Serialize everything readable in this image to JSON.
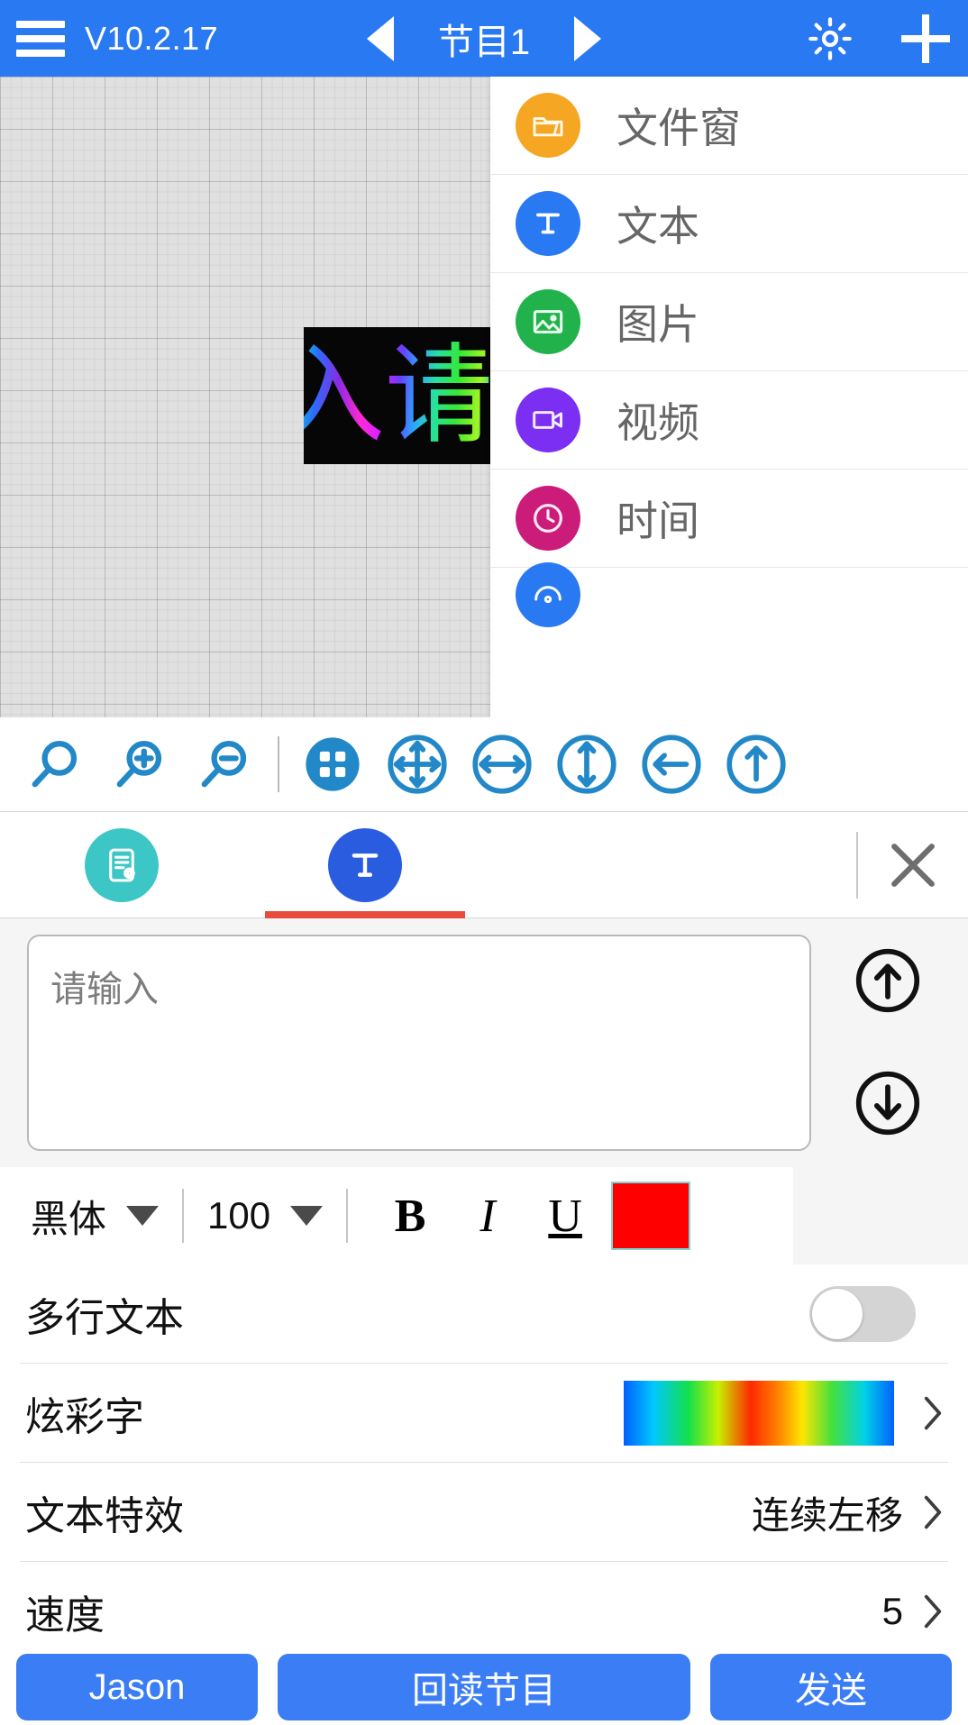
{
  "topbar": {
    "menu_icon": "hamburger-icon",
    "version": "V10.2.17",
    "prev_icon": "triangle-left-icon",
    "program_name": "节目1",
    "next_icon": "triangle-right-icon",
    "brightness_icon": "gear-icon",
    "add_icon": "plus-icon",
    "bg_color": "#2979f2"
  },
  "canvas": {
    "led_preview_text": "入请",
    "led_bg_color": "#060606",
    "grid_bg_color": "#e0e0e0"
  },
  "menu": {
    "items": [
      {
        "label": "文件窗",
        "icon": "folder-icon",
        "color": "#f5a623"
      },
      {
        "label": "文本",
        "icon": "text-t-icon",
        "color": "#2979f2"
      },
      {
        "label": "图片",
        "icon": "image-icon",
        "color": "#22b24c"
      },
      {
        "label": "视频",
        "icon": "video-icon",
        "color": "#7b2ff2"
      },
      {
        "label": "时间",
        "icon": "clock-icon",
        "color": "#cc1c7a"
      },
      {
        "label": "",
        "icon": "dial-icon",
        "color": "#2979f2"
      }
    ]
  },
  "zoom_toolbar": {
    "buttons": [
      {
        "name": "zoom-fit-icon"
      },
      {
        "name": "zoom-in-icon"
      },
      {
        "name": "zoom-out-icon"
      },
      {
        "name": "grid-icon"
      },
      {
        "name": "fit-all-icon"
      },
      {
        "name": "fit-width-icon"
      },
      {
        "name": "fit-height-icon"
      },
      {
        "name": "align-left-icon"
      },
      {
        "name": "align-top-icon"
      }
    ]
  },
  "tabs": {
    "items": [
      {
        "name": "program-settings-tab",
        "icon": "document-gear-icon",
        "color": "#3cc6c6",
        "active": false
      },
      {
        "name": "text-tab",
        "icon": "text-t-icon",
        "color": "#2a5ce0",
        "active": true
      }
    ],
    "close_icon": "close-icon",
    "active_underline_color": "#e74c3c"
  },
  "text_editor": {
    "placeholder": "请输入",
    "value": "",
    "scroll_up_icon": "circle-arrow-up-icon",
    "scroll_down_icon": "circle-arrow-down-icon"
  },
  "font_toolbar": {
    "font_family": "黑体",
    "font_size": "100",
    "bold_label": "B",
    "italic_label": "I",
    "underline_label": "U",
    "color_value": "#ff0000"
  },
  "options": [
    {
      "label": "多行文本",
      "type": "toggle",
      "value": "off"
    },
    {
      "label": "炫彩字",
      "type": "gradient",
      "value": "rainbow"
    },
    {
      "label": "文本特效",
      "type": "nav",
      "value": "连续左移"
    },
    {
      "label": "速度",
      "type": "nav",
      "value": "5"
    }
  ],
  "bottom_buttons": {
    "device_label": "Jason",
    "readback_label": "回读节目",
    "send_label": "发送",
    "color": "#3b7df4"
  }
}
